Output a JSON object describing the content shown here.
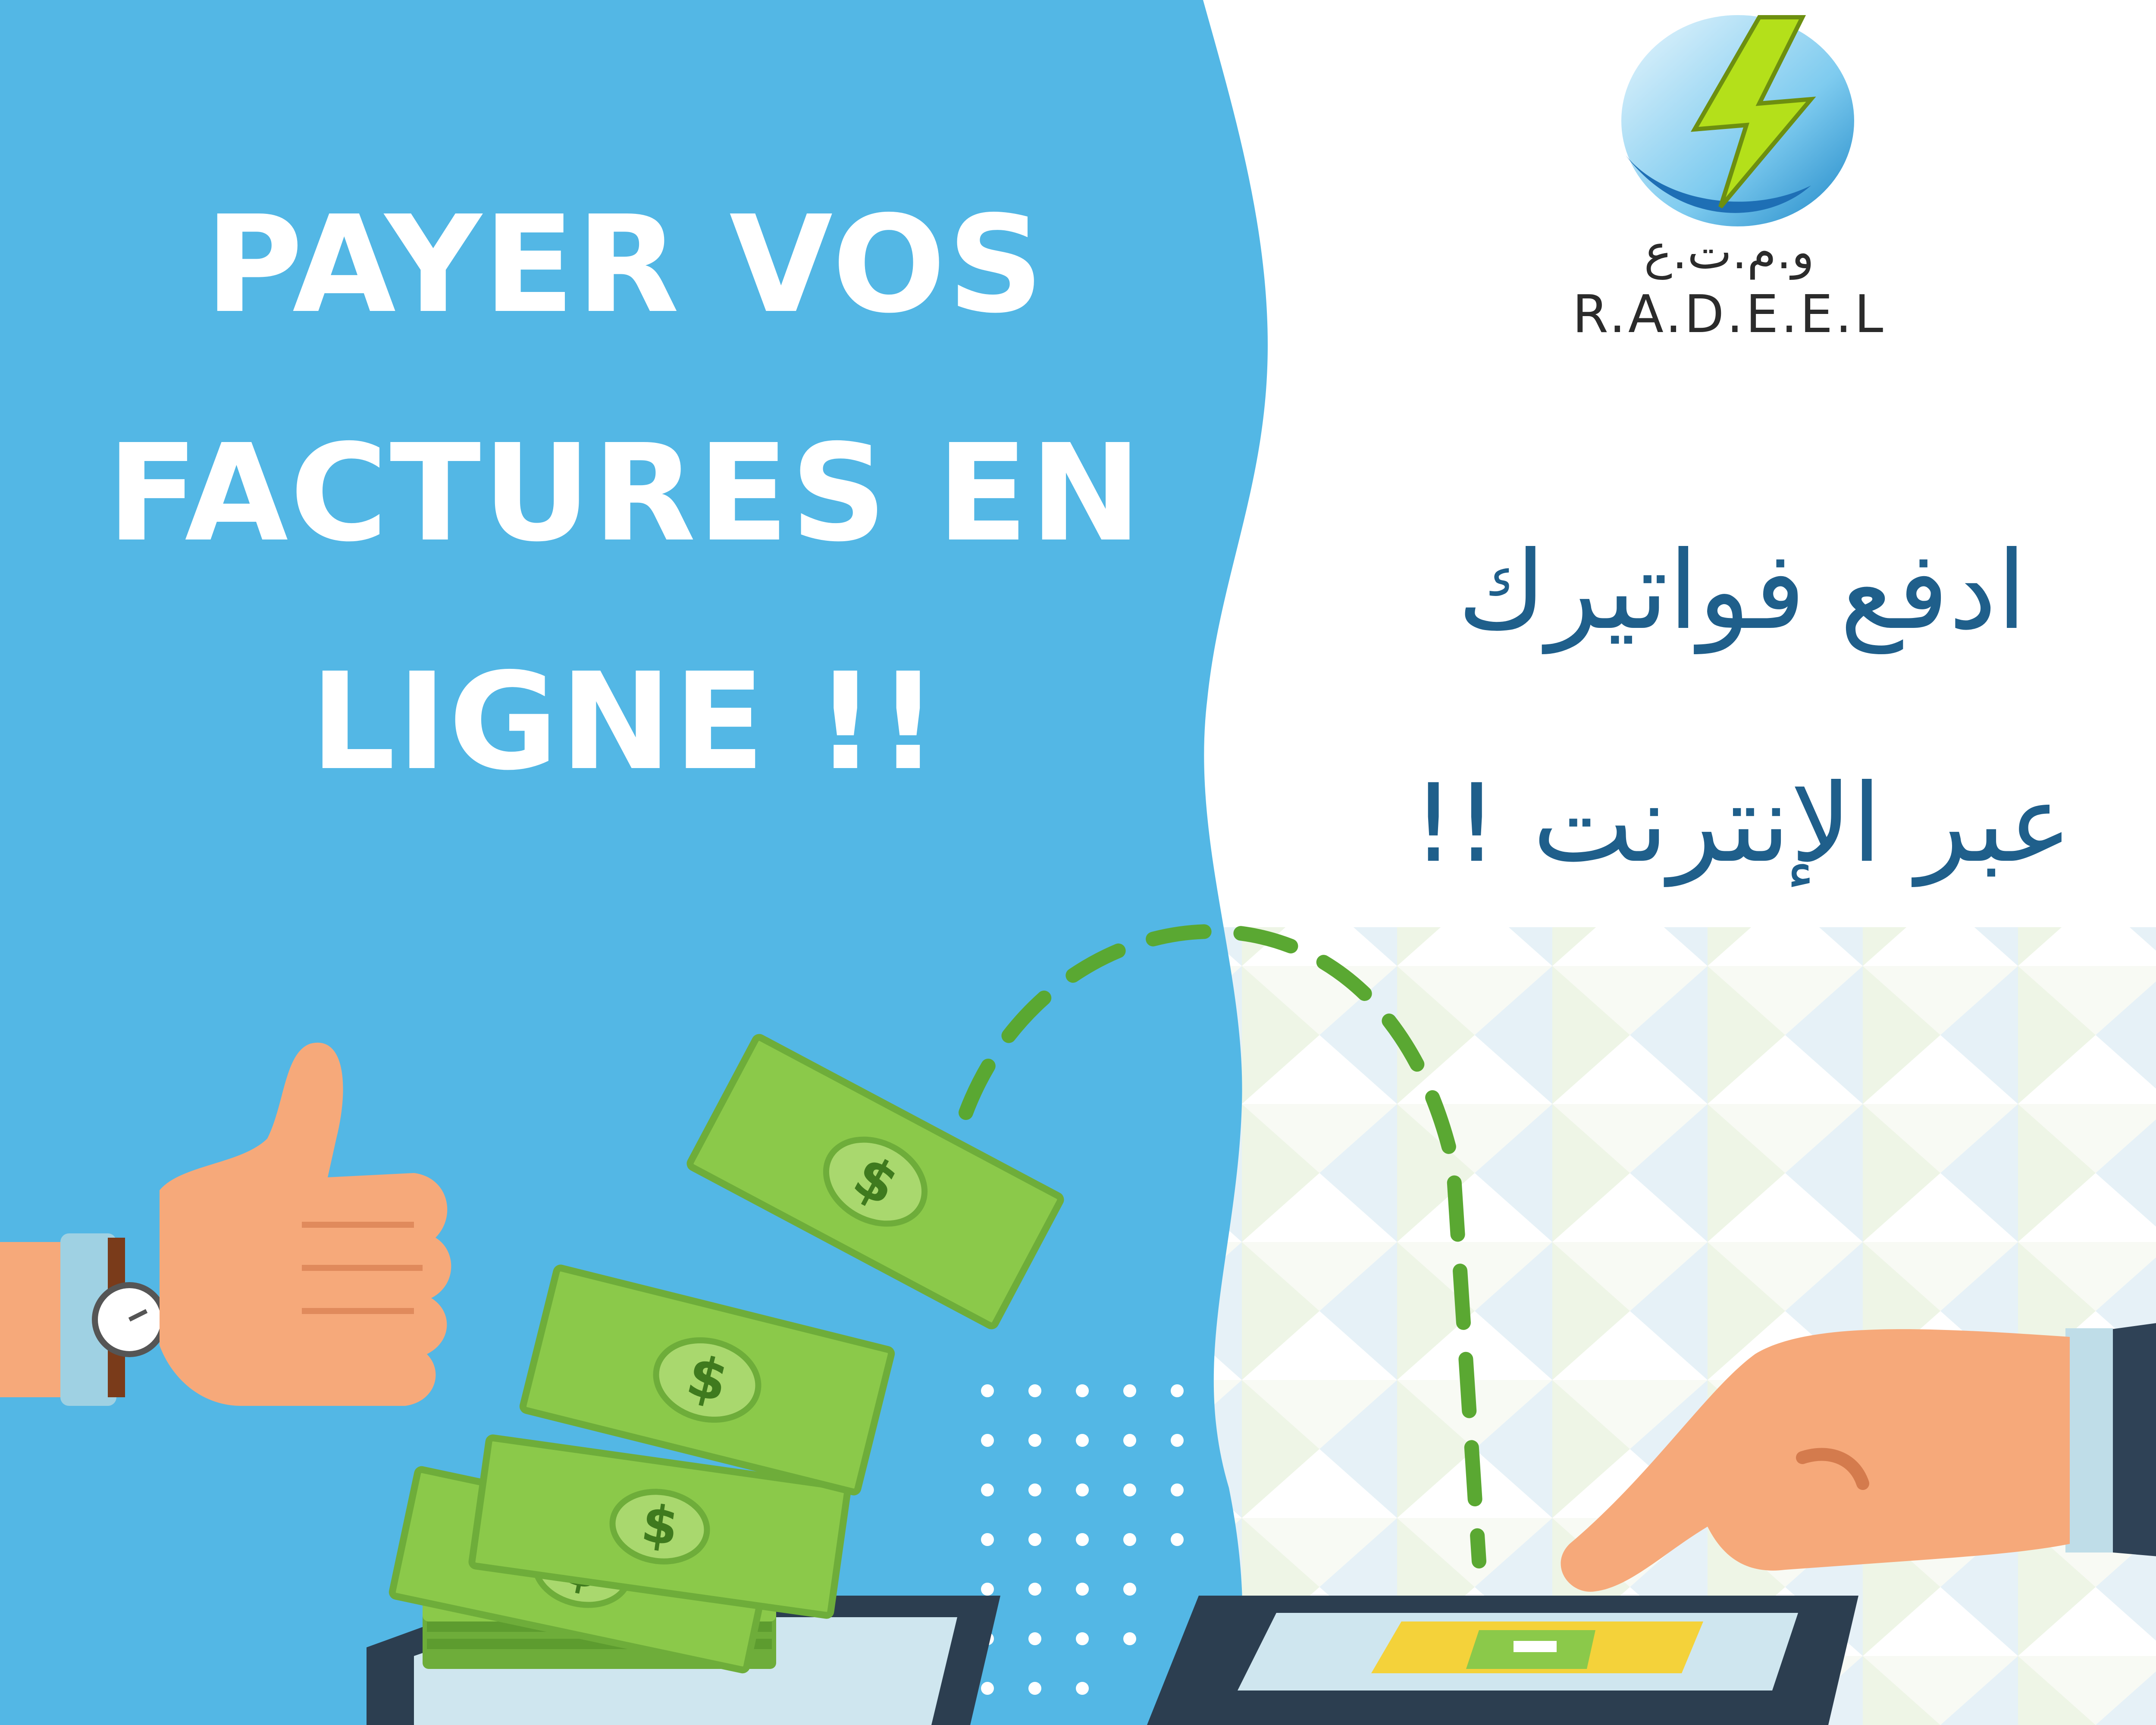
{
  "headline_fr": {
    "line1": "PAYER VOS",
    "line2": "FACTURES EN",
    "line3": "LIGNE !!"
  },
  "headline_ar": {
    "line1": "ادفع فواتيرك",
    "line2": "عبر الإنترنت !!"
  },
  "logo": {
    "arabic_text": "و.م.ت.ع",
    "latin_text": "R.A.D.E.E.L"
  },
  "colors": {
    "background_blue": "#53b7e5",
    "headline_fr": "#ffffff",
    "headline_ar": "#1f5f8b",
    "money_green": "#8bc94a",
    "dashed_arrow": "#5aa832",
    "skin": "#f6a97a",
    "phone": "#2c3e50",
    "bolt_yellow": "#b4e01a"
  },
  "icons": [
    "lightning-bolt-icon",
    "dollar-sign-icon",
    "thumbs-up-icon",
    "pointing-finger-icon"
  ]
}
